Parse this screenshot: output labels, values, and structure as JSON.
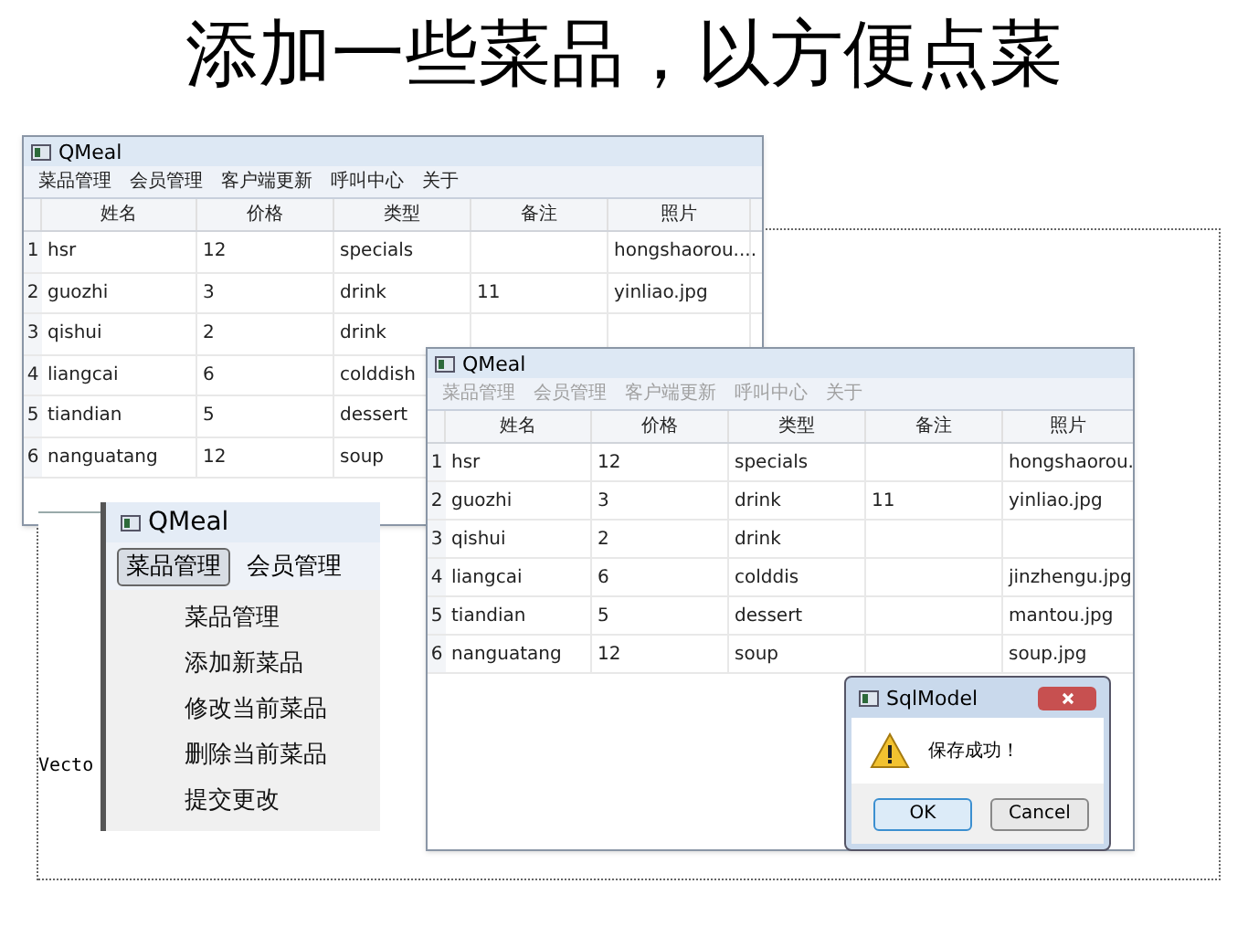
{
  "slide_title": "添加一些菜品，以方便点菜",
  "window_main": {
    "title": "QMeal",
    "menu": [
      {
        "label": "菜品管理",
        "disabled": false
      },
      {
        "label": "会员管理",
        "disabled": false
      },
      {
        "label": "客户端更新",
        "disabled": false
      },
      {
        "label": "呼叫中心",
        "disabled": false
      },
      {
        "label": "关于",
        "disabled": false
      }
    ],
    "columns": [
      "姓名",
      "价格",
      "类型",
      "备注",
      "照片"
    ],
    "rows": [
      {
        "num": "1",
        "cells": [
          "hsr",
          "12",
          "specials",
          "",
          "hongshaorou...."
        ]
      },
      {
        "num": "2",
        "cells": [
          "guozhi",
          "3",
          "drink",
          "11",
          "yinliao.jpg"
        ]
      },
      {
        "num": "3",
        "cells": [
          "qishui",
          "2",
          "drink",
          "",
          ""
        ]
      },
      {
        "num": "4",
        "cells": [
          "liangcai",
          "6",
          "colddish"
        ]
      },
      {
        "num": "5",
        "cells": [
          "tiandian",
          "5",
          "dessert"
        ]
      },
      {
        "num": "6",
        "cells": [
          "nanguatang",
          "12",
          "soup"
        ]
      }
    ]
  },
  "window_saved": {
    "title": "QMeal",
    "menu": [
      {
        "label": "菜品管理",
        "disabled": true
      },
      {
        "label": "会员管理",
        "disabled": true
      },
      {
        "label": "客户端更新",
        "disabled": true
      },
      {
        "label": "呼叫中心",
        "disabled": true
      },
      {
        "label": "关于",
        "disabled": true
      }
    ],
    "columns": [
      "姓名",
      "价格",
      "类型",
      "备注",
      "照片"
    ],
    "rows": [
      {
        "num": "1",
        "cells": [
          "hsr",
          "12",
          "specials",
          "",
          "hongshaorou."
        ]
      },
      {
        "num": "2",
        "cells": [
          "guozhi",
          "3",
          "drink",
          "11",
          "yinliao.jpg"
        ]
      },
      {
        "num": "3",
        "cells": [
          "qishui",
          "2",
          "drink",
          "",
          ""
        ]
      },
      {
        "num": "4",
        "cells": [
          "liangcai",
          "6",
          "colddis",
          "",
          "jinzhengu.jpg"
        ]
      },
      {
        "num": "5",
        "cells": [
          "tiandian",
          "5",
          "dessert",
          "",
          "mantou.jpg"
        ]
      },
      {
        "num": "6",
        "cells": [
          "nanguatang",
          "12",
          "soup",
          "",
          "soup.jpg"
        ]
      }
    ]
  },
  "window_menu": {
    "title": "QMeal",
    "menu": [
      {
        "label": "菜品管理",
        "selected": true
      },
      {
        "label": "会员管理",
        "selected": false
      }
    ],
    "dropdown": [
      "菜品管理",
      "添加新菜品",
      "修改当前菜品",
      "删除当前菜品",
      "提交更改"
    ]
  },
  "background_fragment": {
    "text": "Vecto"
  },
  "dialog": {
    "title": "SqlModel",
    "message": "保存成功！",
    "buttons": [
      {
        "label": "OK",
        "default": true
      },
      {
        "label": "Cancel",
        "default": false
      }
    ]
  }
}
